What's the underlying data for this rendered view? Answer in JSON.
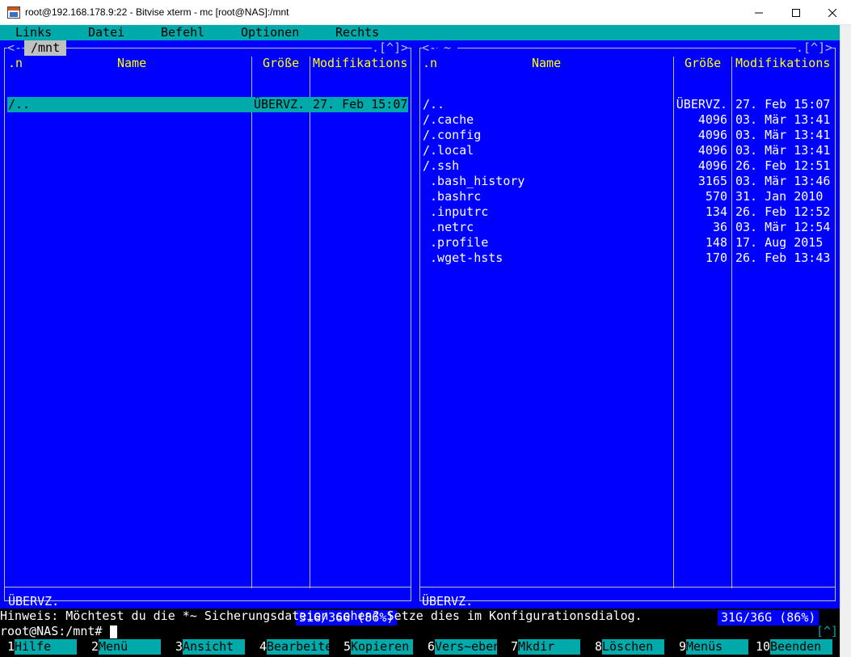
{
  "window": {
    "title": "root@192.168.178.9:22 - Bitvise xterm - mc [root@NAS]:/mnt",
    "icon": "bitvise-terminal-icon"
  },
  "menubar": [
    "Links",
    "Datei",
    "Befehl",
    "Optionen",
    "Rechts"
  ],
  "left_panel": {
    "corner_left": "<-",
    "path": "/mnt",
    "corner_right": ".[^]>",
    "headers": {
      "sort": ".n",
      "name": "Name",
      "size": "Größe",
      "mtime": "Modifikations"
    },
    "rows": [
      {
        "name": "/..",
        "size": "ÜBERVZ.",
        "mtime": "27. Feb 15:07",
        "selected": true
      }
    ],
    "status": "ÜBERVZ.",
    "disk": "31G/36G (86%)"
  },
  "right_panel": {
    "corner_left": "<-",
    "path": "~",
    "corner_right": ".[^]>",
    "headers": {
      "sort": ".n",
      "name": "Name",
      "size": "Größe",
      "mtime": "Modifikations"
    },
    "rows": [
      {
        "name": "/..",
        "size": "ÜBERVZ.",
        "mtime": "27. Feb 15:07"
      },
      {
        "name": "/.cache",
        "size": "4096",
        "mtime": "03. Mär 13:41"
      },
      {
        "name": "/.config",
        "size": "4096",
        "mtime": "03. Mär 13:41"
      },
      {
        "name": "/.local",
        "size": "4096",
        "mtime": "03. Mär 13:41"
      },
      {
        "name": "/.ssh",
        "size": "4096",
        "mtime": "26. Feb 12:51"
      },
      {
        "name": " .bash_history",
        "size": "3165",
        "mtime": "03. Mär 13:46"
      },
      {
        "name": " .bashrc",
        "size": "570",
        "mtime": "31. Jan 2010"
      },
      {
        "name": " .inputrc",
        "size": "134",
        "mtime": "26. Feb 12:52"
      },
      {
        "name": " .netrc",
        "size": "36",
        "mtime": "03. Mär 12:54"
      },
      {
        "name": " .profile",
        "size": "148",
        "mtime": "17. Aug 2015"
      },
      {
        "name": " .wget-hsts",
        "size": "170",
        "mtime": "26. Feb 13:43"
      }
    ],
    "status": "ÜBERVZ.",
    "disk": "31G/36G (86%)"
  },
  "hint": "Hinweis: Möchtest du die *~ Sicherungsdateien sehen? Setze dies im Konfigurationsdialog.",
  "prompt": "root@NAS:/mnt#",
  "prompt_caret": "[^]",
  "fkeys": [
    {
      "num": "1",
      "label": "Hilfe"
    },
    {
      "num": "2",
      "label": "Menü"
    },
    {
      "num": "3",
      "label": "Ansicht"
    },
    {
      "num": "4",
      "label": "Bearbeiten"
    },
    {
      "num": "5",
      "label": "Kopieren"
    },
    {
      "num": "6",
      "label": "Vers~eben"
    },
    {
      "num": "7",
      "label": "Mkdir"
    },
    {
      "num": "8",
      "label": "Löschen"
    },
    {
      "num": "9",
      "label": "Menüs"
    },
    {
      "num": "10",
      "label": "Beenden"
    }
  ],
  "colors": {
    "panel_bg": "#0000ff",
    "cyan": "#00aaaa",
    "header_yellow": "#ffff00",
    "frame": "#c0c0c0",
    "terminal_bg": "#000000"
  }
}
